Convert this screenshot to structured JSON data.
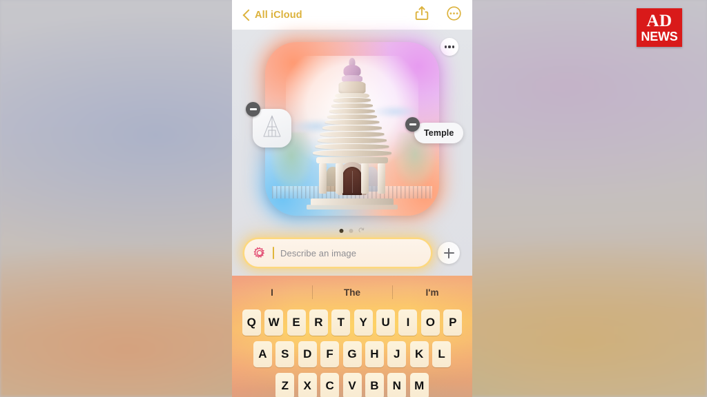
{
  "watermark": {
    "line1": "AD",
    "line2": "NEWS"
  },
  "navbar": {
    "back_label": "All iCloud",
    "share_icon": "share-icon",
    "more_icon": "more-circle-icon"
  },
  "content": {
    "card_menu_icon": "ellipsis-icon",
    "image_alt": "temple-illustration",
    "chips": [
      {
        "name": "sketch-chip",
        "type": "sketch",
        "label": ""
      },
      {
        "name": "temple-chip",
        "type": "text",
        "label": "Temple"
      }
    ],
    "page_dots": {
      "count": 2,
      "active_index": 0,
      "redo_icon": "redo-icon"
    }
  },
  "prompt": {
    "icon": "image-playground-icon",
    "placeholder": "Describe an image",
    "value": "",
    "add_button_icon": "plus-icon"
  },
  "keyboard": {
    "predictions": [
      "I",
      "The",
      "I'm"
    ],
    "row1": [
      "Q",
      "W",
      "E",
      "R",
      "T",
      "Y",
      "U",
      "I",
      "O",
      "P"
    ],
    "row2": [
      "A",
      "S",
      "D",
      "F",
      "G",
      "H",
      "J",
      "K",
      "L"
    ],
    "row3": [
      "Z",
      "X",
      "C",
      "V",
      "B",
      "N",
      "M"
    ]
  },
  "colors": {
    "accent_gold": "#dcb23c",
    "brand_red": "#d91a1a",
    "keyboard_highlight": "#fdd266"
  }
}
